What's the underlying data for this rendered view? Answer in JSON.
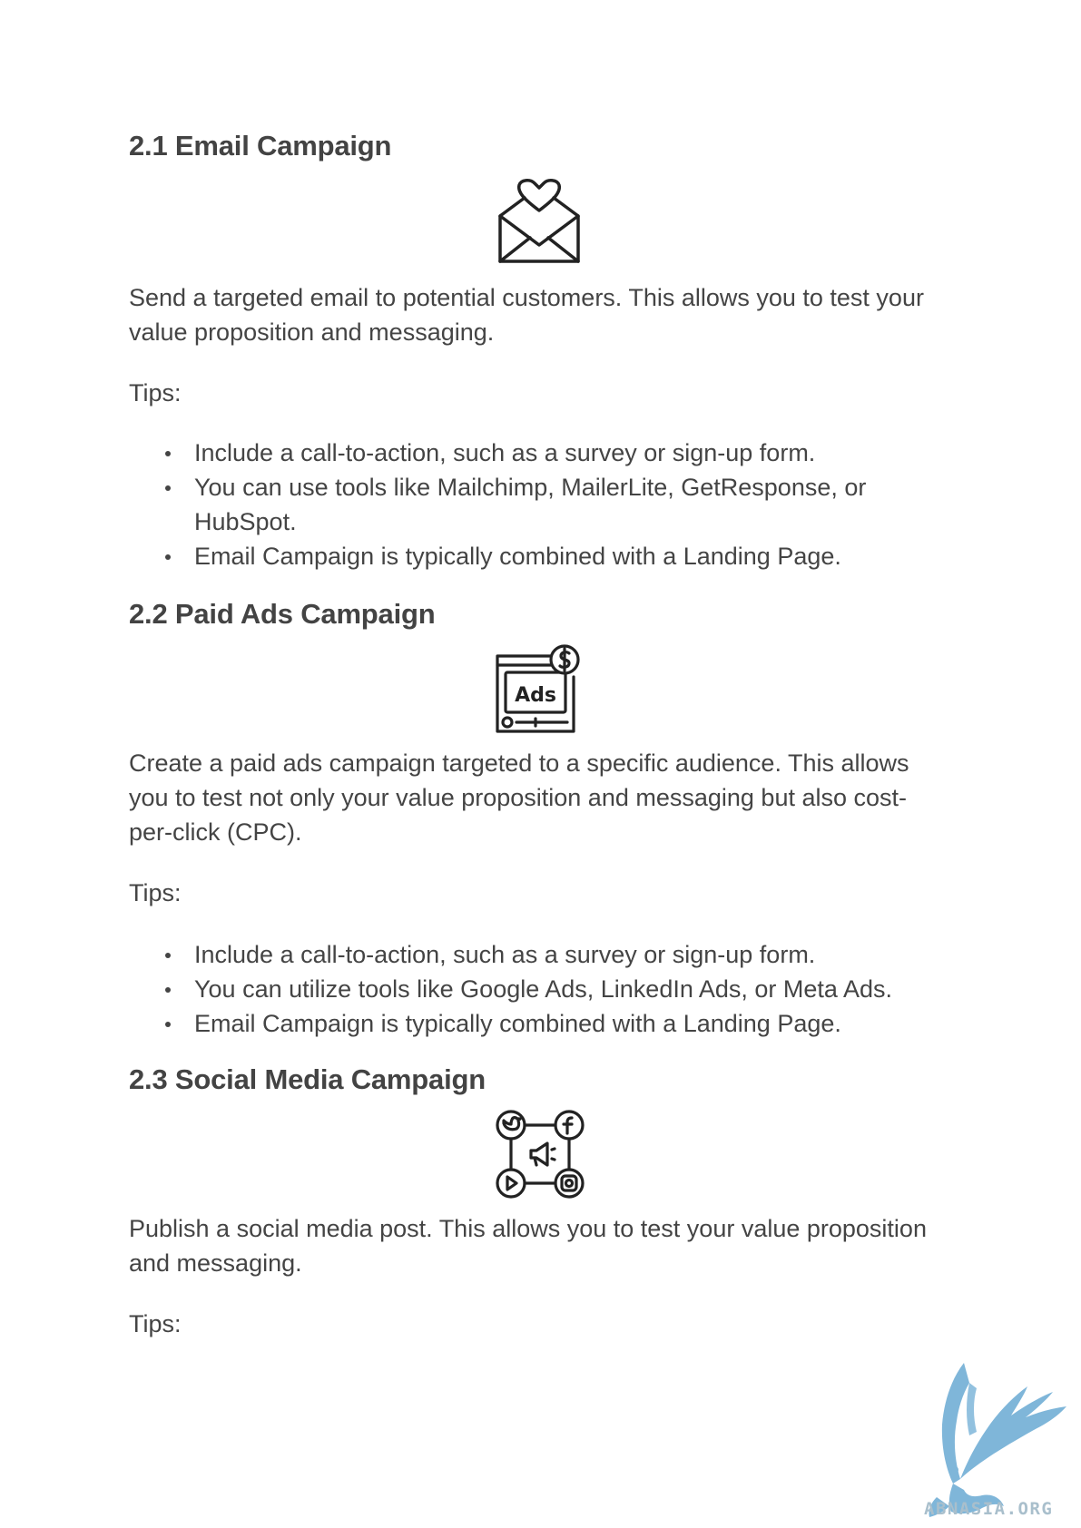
{
  "sections": [
    {
      "heading": "2.1 Email Campaign",
      "icon": "email-heart-icon",
      "description": "Send a targeted email to potential customers. This allows you to test your value proposition and messaging.",
      "tips_label": "Tips:",
      "tips": [
        "Include a call-to-action, such as a survey or sign-up form.",
        "You can use tools like Mailchimp, MailerLite, GetResponse, or HubSpot.",
        "Email Campaign is typically combined with a Landing Page."
      ]
    },
    {
      "heading": "2.2 Paid Ads Campaign",
      "icon": "ads-browser-icon",
      "icon_text": "Ads",
      "description": "Create a paid ads campaign targeted to a specific audience. This allows you to test not only your value proposition and messaging but also cost-per-click (CPC).",
      "tips_label": "Tips:",
      "tips": [
        "Include a call-to-action, such as a survey or sign-up form.",
        "You can utilize tools like Google Ads, LinkedIn Ads, or Meta Ads.",
        "Email Campaign is typically combined with a Landing Page."
      ]
    },
    {
      "heading": "2.3 Social Media Campaign",
      "icon": "social-network-icon",
      "description": "Publish a social media post. This allows you to test your value proposition and messaging.",
      "tips_label": "Tips:"
    }
  ],
  "watermark": {
    "text": "ABNASIA.ORG",
    "icon": "griffin-logo-icon",
    "color": "#7fb6d9"
  }
}
